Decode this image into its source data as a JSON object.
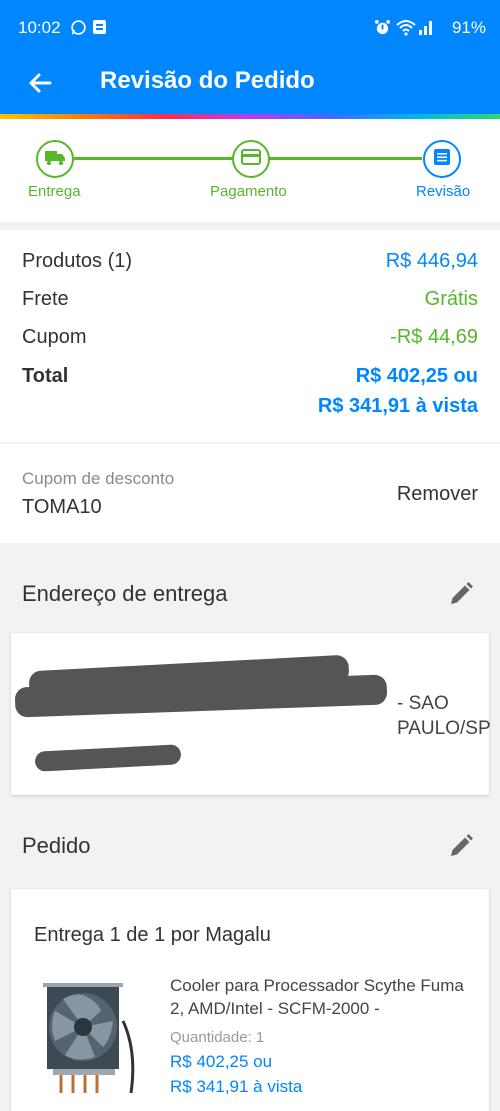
{
  "status_bar": {
    "time": "10:02",
    "battery": "91%",
    "icons": [
      "whatsapp-icon",
      "app-notification-icon",
      "alarm-icon",
      "wifi-icon",
      "signal-icon"
    ]
  },
  "app_bar": {
    "title": "Revisão do Pedido"
  },
  "stepper": {
    "steps": [
      {
        "label": "Entrega",
        "icon": "truck-icon",
        "state": "done"
      },
      {
        "label": "Pagamento",
        "icon": "card-icon",
        "state": "done"
      },
      {
        "label": "Revisão",
        "icon": "list-icon",
        "state": "active"
      }
    ]
  },
  "summary": {
    "products_label": "Produtos (1)",
    "products_value": "R$ 446,94",
    "shipping_label": "Frete",
    "shipping_value": "Grátis",
    "coupon_label": "Cupom",
    "coupon_value": "-R$ 44,69",
    "total_label": "Total",
    "total_value_line1": "R$ 402,25 ou",
    "total_value_line2": "R$ 341,91 à vista"
  },
  "coupon": {
    "label": "Cupom de desconto",
    "code": "TOMA10",
    "remove_label": "Remover"
  },
  "address": {
    "section_title": "Endereço de entrega",
    "text": "- SAO PAULO/SP"
  },
  "order": {
    "section_title": "Pedido",
    "delivery_title": "Entrega 1 de 1 por Magalu",
    "product_name": "Cooler para Processador Scythe Fuma 2, AMD/Intel -  SCFM-2000 -",
    "quantity_label": "Quantidade:",
    "quantity_value": "1",
    "price_line1": "R$ 402,25 ou",
    "price_line2": "R$ 341,91 à vista"
  },
  "colors": {
    "primary": "#0086ff",
    "success": "#56b72b",
    "redaction": "#555555"
  }
}
